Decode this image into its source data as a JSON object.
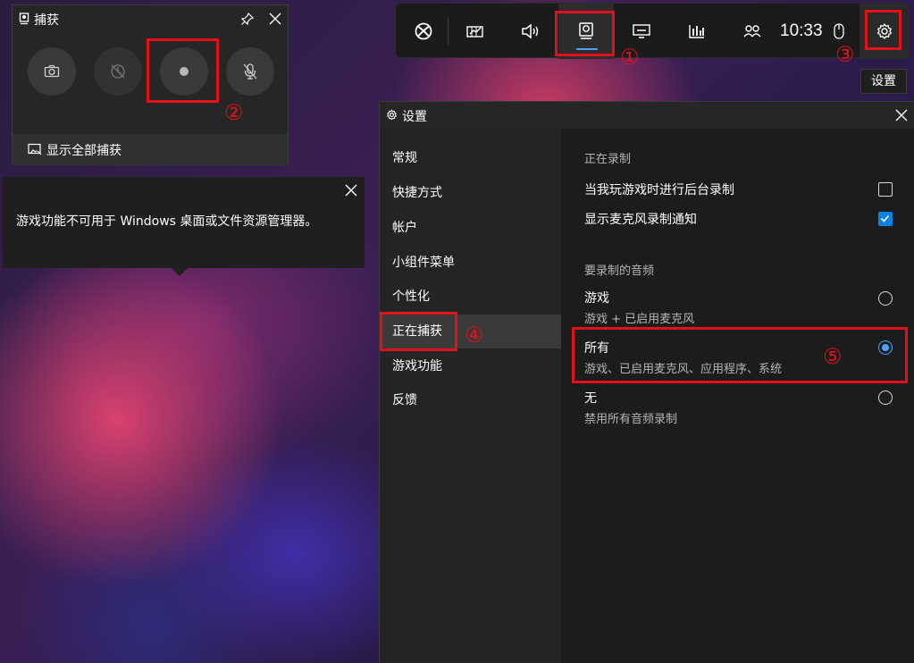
{
  "game_bar": {
    "clock": "10:33",
    "icons": [
      "xbox-icon",
      "performance-widget-icon",
      "audio-icon",
      "capture-icon",
      "screen-icon",
      "stats-icon",
      "social-icon",
      "mouse-icon",
      "gear-icon"
    ],
    "accent_color": "#4aa3ff",
    "settings_tooltip": "设置"
  },
  "capture_widget": {
    "title": "捕获",
    "show_all_captures": "显示全部捕获",
    "buttons": [
      "screenshot",
      "record-last-30s",
      "start-recording",
      "microphone-off"
    ]
  },
  "notice": {
    "message": "游戏功能不可用于 Windows 桌面或文件资源管理器。"
  },
  "settings": {
    "title": "设置",
    "nav": [
      {
        "label": "常规"
      },
      {
        "label": "快捷方式"
      },
      {
        "label": "帐户"
      },
      {
        "label": "小组件菜单"
      },
      {
        "label": "个性化"
      },
      {
        "label": "正在捕获",
        "active": true
      },
      {
        "label": "游戏功能"
      },
      {
        "label": "反馈"
      }
    ],
    "recording_section": {
      "heading": "正在录制",
      "background_recording": {
        "label": "当我玩游戏时进行后台录制",
        "checked": false
      },
      "mic_notification": {
        "label": "显示麦克风录制通知",
        "checked": true
      }
    },
    "audio_section": {
      "heading": "要录制的音频",
      "options": [
        {
          "label": "游戏",
          "desc": "游戏 + 已启用麦克风",
          "selected": false
        },
        {
          "label": "所有",
          "desc": "游戏、已启用麦克风、应用程序、系统",
          "selected": true
        },
        {
          "label": "无",
          "desc": "禁用所有音频录制",
          "selected": false
        }
      ]
    }
  },
  "annotations": {
    "color": "#e3101c",
    "markers": [
      "①",
      "②",
      "③",
      "④",
      "⑤"
    ]
  }
}
